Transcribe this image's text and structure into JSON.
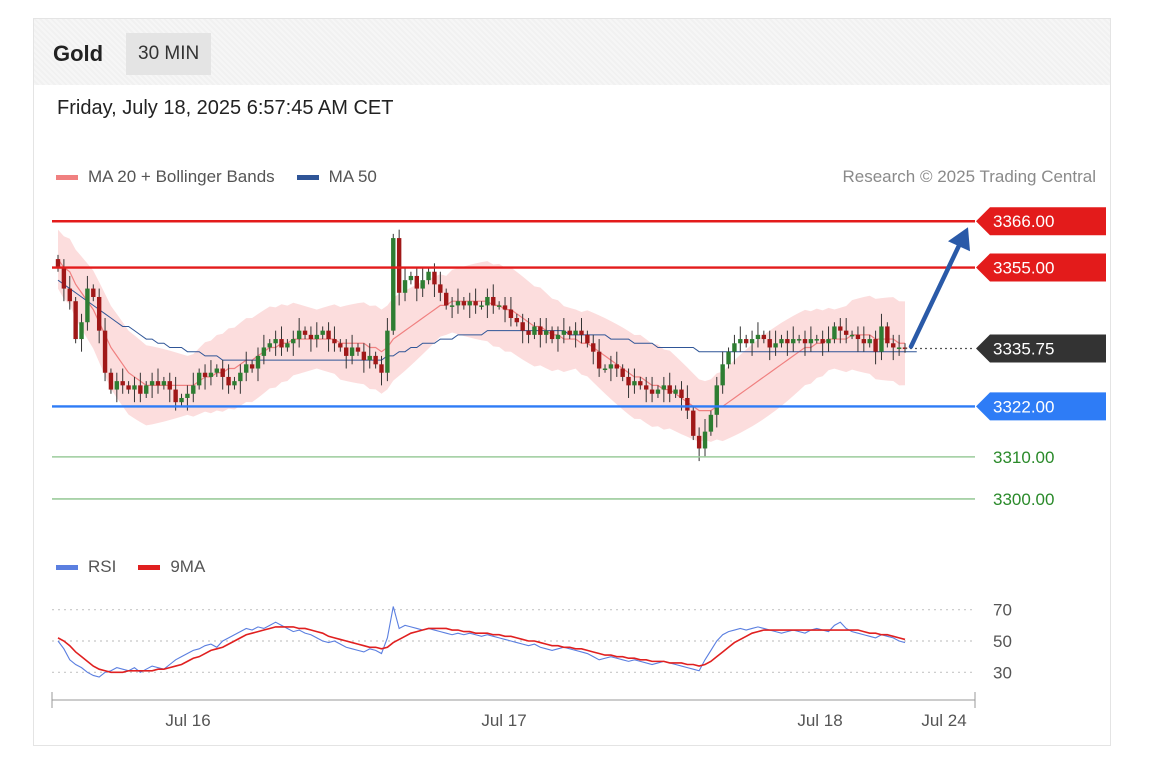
{
  "header": {
    "title": "Gold",
    "timeframe": "30 MIN"
  },
  "datetime": "Friday, July 18, 2025 6:57:45 AM CET",
  "legend": {
    "ma20_label": "MA 20 + Bollinger Bands",
    "ma50_label": "MA 50",
    "ma20_color": "#f08080",
    "ma50_color": "#2f5597"
  },
  "copyright": "Research © 2025 Trading Central",
  "rsi_legend": {
    "rsi_label": "RSI",
    "ma_label": "9MA",
    "rsi_color": "#5b7fe0",
    "ma_color": "#e02020"
  },
  "colors": {
    "resistance": "#e31b1b",
    "support": "#2e7cf6",
    "target": "#2a8a2a",
    "current": "#333333",
    "up_candle": "#2e7d32",
    "down_candle": "#a01818",
    "arrow": "#2a5aa8"
  },
  "chart_data": [
    {
      "type": "candlestick",
      "title": "Gold",
      "ylim": [
        3295,
        3372
      ],
      "x_ticks": [
        "Jul 16",
        "Jul 17",
        "Jul 18",
        "Jul 24"
      ],
      "levels": [
        {
          "value": 3366.0,
          "label": "3366.00",
          "kind": "resistance"
        },
        {
          "value": 3355.0,
          "label": "3355.00",
          "kind": "resistance"
        },
        {
          "value": 3335.75,
          "label": "3335.75",
          "kind": "current"
        },
        {
          "value": 3322.0,
          "label": "3322.00",
          "kind": "support"
        },
        {
          "value": 3310.0,
          "label": "3310.00",
          "kind": "target"
        },
        {
          "value": 3300.0,
          "label": "3300.00",
          "kind": "target"
        }
      ],
      "close": [
        3355,
        3350,
        3347,
        3338,
        3342,
        3350,
        3348,
        3340,
        3330,
        3326,
        3328,
        3327,
        3326,
        3327,
        3325,
        3327,
        3328,
        3327,
        3328,
        3326,
        3323,
        3324,
        3325,
        3327,
        3330,
        3329,
        3330,
        3331,
        3329,
        3327,
        3328,
        3330,
        3332,
        3331,
        3334,
        3336,
        3337,
        3338,
        3336,
        3337,
        3338,
        3340,
        3339,
        3338,
        3339,
        3340,
        3338,
        3337,
        3336,
        3334,
        3336,
        3335,
        3333,
        3334,
        3332,
        3330,
        3340,
        3362,
        3349,
        3352,
        3353,
        3350,
        3352,
        3354,
        3351,
        3349,
        3346,
        3346,
        3347,
        3346,
        3347,
        3346,
        3346,
        3348,
        3346,
        3346,
        3345,
        3343,
        3342,
        3340,
        3339,
        3341,
        3339,
        3340,
        3338,
        3339,
        3340,
        3339,
        3340,
        3339,
        3337,
        3335,
        3331,
        3331,
        3332,
        3331,
        3329,
        3327,
        3328,
        3327,
        3326,
        3325,
        3326,
        3327,
        3325,
        3326,
        3324,
        3321,
        3315,
        3312,
        3316,
        3320,
        3327,
        3332,
        3335,
        3337,
        3338,
        3337,
        3338,
        3339,
        3338,
        3336,
        3337,
        3338,
        3337,
        3338,
        3338,
        3337,
        3338,
        3338,
        3337,
        3338,
        3341,
        3340,
        3339,
        3339,
        3338,
        3337,
        3338,
        3335,
        3341,
        3337,
        3336,
        3336,
        3335.75
      ],
      "ma20": [
        3357,
        3355,
        3354,
        3351,
        3349,
        3347,
        3345,
        3342,
        3339,
        3336,
        3334,
        3332,
        3330,
        3329,
        3328,
        3327,
        3327,
        3327,
        3327,
        3327,
        3327,
        3327,
        3327,
        3327,
        3328,
        3329,
        3329,
        3330,
        3330,
        3331,
        3331,
        3332,
        3333,
        3333,
        3334,
        3335,
        3336,
        3336,
        3337,
        3337,
        3338,
        3338,
        3338,
        3338,
        3338,
        3338,
        3338,
        3338,
        3337,
        3337,
        3337,
        3337,
        3337,
        3336,
        3336,
        3335,
        3336,
        3338,
        3339,
        3340,
        3341,
        3342,
        3343,
        3344,
        3345,
        3346,
        3346,
        3347,
        3347,
        3347,
        3347,
        3347,
        3347,
        3347,
        3346,
        3346,
        3345,
        3345,
        3344,
        3343,
        3342,
        3341,
        3341,
        3340,
        3339,
        3339,
        3338,
        3338,
        3338,
        3337,
        3337,
        3336,
        3335,
        3334,
        3333,
        3332,
        3331,
        3330,
        3329,
        3329,
        3328,
        3327,
        3327,
        3326,
        3326,
        3325,
        3324,
        3323,
        3322,
        3321,
        3321,
        3321,
        3322,
        3322,
        3323,
        3324,
        3325,
        3326,
        3327,
        3328,
        3329,
        3330,
        3331,
        3332,
        3333,
        3334,
        3335,
        3336,
        3336,
        3337,
        3337,
        3338,
        3338,
        3338,
        3338,
        3339,
        3339,
        3339,
        3339,
        3338,
        3338,
        3338,
        3338,
        3337,
        3337
      ],
      "ma50": [
        3352,
        3351,
        3350,
        3349,
        3348,
        3347,
        3346,
        3345,
        3344,
        3343,
        3342,
        3341,
        3341,
        3340,
        3339,
        3338,
        3338,
        3337,
        3337,
        3336,
        3336,
        3336,
        3335,
        3335,
        3335,
        3334,
        3334,
        3334,
        3333,
        3333,
        3333,
        3333,
        3333,
        3333,
        3333,
        3333,
        3333,
        3333,
        3333,
        3333,
        3333,
        3333,
        3333,
        3333,
        3333,
        3333,
        3333,
        3333,
        3333,
        3333,
        3333,
        3333,
        3333,
        3333,
        3333,
        3333,
        3334,
        3334,
        3335,
        3335,
        3336,
        3336,
        3337,
        3337,
        3337,
        3338,
        3338,
        3338,
        3339,
        3339,
        3339,
        3339,
        3339,
        3340,
        3340,
        3340,
        3340,
        3340,
        3340,
        3340,
        3340,
        3340,
        3340,
        3340,
        3340,
        3340,
        3340,
        3339,
        3339,
        3339,
        3339,
        3339,
        3339,
        3339,
        3338,
        3338,
        3338,
        3338,
        3337,
        3337,
        3337,
        3337,
        3336,
        3336,
        3336,
        3336,
        3336,
        3336,
        3336,
        3335,
        3335,
        3335,
        3335,
        3335,
        3335,
        3335,
        3335,
        3335,
        3335,
        3335,
        3335,
        3335,
        3335,
        3335,
        3335,
        3335,
        3335,
        3335,
        3335,
        3335,
        3335,
        3335,
        3335,
        3335,
        3335,
        3335,
        3335,
        3335,
        3335,
        3335,
        3335,
        3335,
        3335,
        3335,
        3335,
        3335,
        3335
      ],
      "target_arrow": {
        "from": 3335.75,
        "to": 3366.0
      }
    },
    {
      "type": "line",
      "title": "RSI",
      "ylim": [
        20,
        80
      ],
      "y_ticks": [
        70,
        50,
        30
      ],
      "series": [
        {
          "name": "RSI",
          "values": [
            50,
            45,
            38,
            35,
            33,
            30,
            28,
            27,
            30,
            31,
            33,
            32,
            31,
            33,
            30,
            32,
            34,
            33,
            32,
            35,
            38,
            40,
            42,
            44,
            45,
            47,
            48,
            46,
            50,
            52,
            54,
            56,
            58,
            57,
            59,
            58,
            60,
            62,
            60,
            58,
            56,
            57,
            55,
            54,
            52,
            50,
            49,
            50,
            48,
            46,
            45,
            44,
            43,
            45,
            44,
            42,
            52,
            72,
            58,
            60,
            59,
            58,
            57,
            58,
            57,
            56,
            55,
            54,
            55,
            54,
            55,
            54,
            53,
            54,
            53,
            52,
            51,
            50,
            49,
            48,
            47,
            48,
            46,
            45,
            44,
            45,
            46,
            45,
            44,
            43,
            42,
            40,
            38,
            39,
            40,
            39,
            38,
            37,
            38,
            37,
            36,
            35,
            36,
            37,
            36,
            35,
            34,
            33,
            32,
            31,
            38,
            44,
            50,
            54,
            56,
            57,
            58,
            57,
            58,
            59,
            58,
            57,
            56,
            55,
            56,
            57,
            56,
            55,
            57,
            58,
            57,
            56,
            60,
            62,
            58,
            56,
            55,
            54,
            53,
            52,
            54,
            53,
            52,
            50,
            49
          ],
          "color": "#5b7fe0"
        },
        {
          "name": "9MA",
          "values": [
            52,
            50,
            47,
            43,
            40,
            37,
            34,
            32,
            31,
            30,
            30,
            30,
            31,
            31,
            31,
            31,
            31,
            32,
            32,
            33,
            34,
            35,
            37,
            39,
            40,
            42,
            44,
            45,
            46,
            48,
            50,
            52,
            54,
            55,
            56,
            57,
            58,
            59,
            59,
            59,
            59,
            58,
            58,
            57,
            56,
            55,
            53,
            52,
            51,
            50,
            49,
            48,
            47,
            46,
            46,
            45,
            46,
            49,
            51,
            53,
            55,
            56,
            57,
            58,
            58,
            58,
            58,
            57,
            57,
            56,
            56,
            55,
            55,
            55,
            54,
            54,
            53,
            53,
            52,
            51,
            50,
            50,
            49,
            48,
            47,
            47,
            46,
            46,
            45,
            45,
            44,
            43,
            42,
            41,
            41,
            40,
            40,
            39,
            39,
            38,
            38,
            37,
            37,
            37,
            36,
            36,
            36,
            35,
            35,
            34,
            35,
            37,
            40,
            43,
            46,
            49,
            51,
            53,
            55,
            56,
            57,
            57,
            57,
            57,
            57,
            57,
            57,
            57,
            57,
            57,
            57,
            57,
            57,
            57,
            57,
            57,
            57,
            56,
            55,
            55,
            54,
            54,
            53,
            52,
            51
          ],
          "color": "#e02020"
        }
      ]
    }
  ]
}
